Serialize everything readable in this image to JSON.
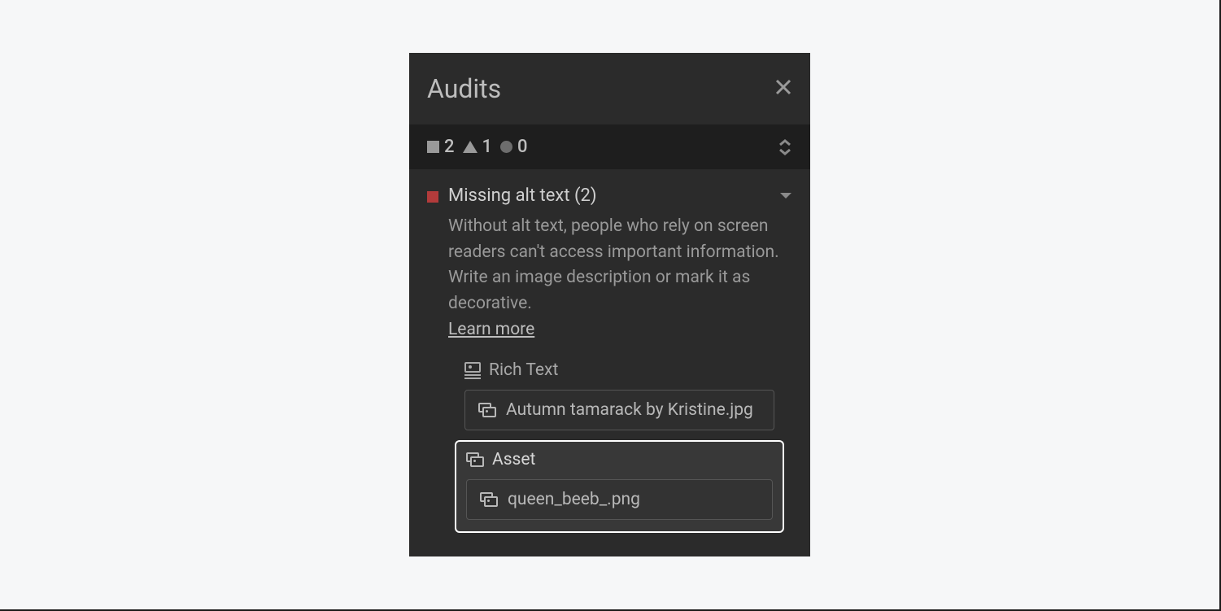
{
  "panel": {
    "title": "Audits"
  },
  "summary": {
    "errors": "2",
    "warnings": "1",
    "info": "0"
  },
  "issue": {
    "title": "Missing alt text (2)",
    "description": "Without alt text, people who rely on screen readers can't access important information. Write an image description or mark it as decorative.",
    "learn_more": "Learn more"
  },
  "groups": {
    "rich_text": {
      "label": "Rich Text",
      "item": "Autumn tamarack by Kristine.jpg"
    },
    "asset": {
      "label": "Asset",
      "item": "queen_beeb_.png"
    }
  }
}
